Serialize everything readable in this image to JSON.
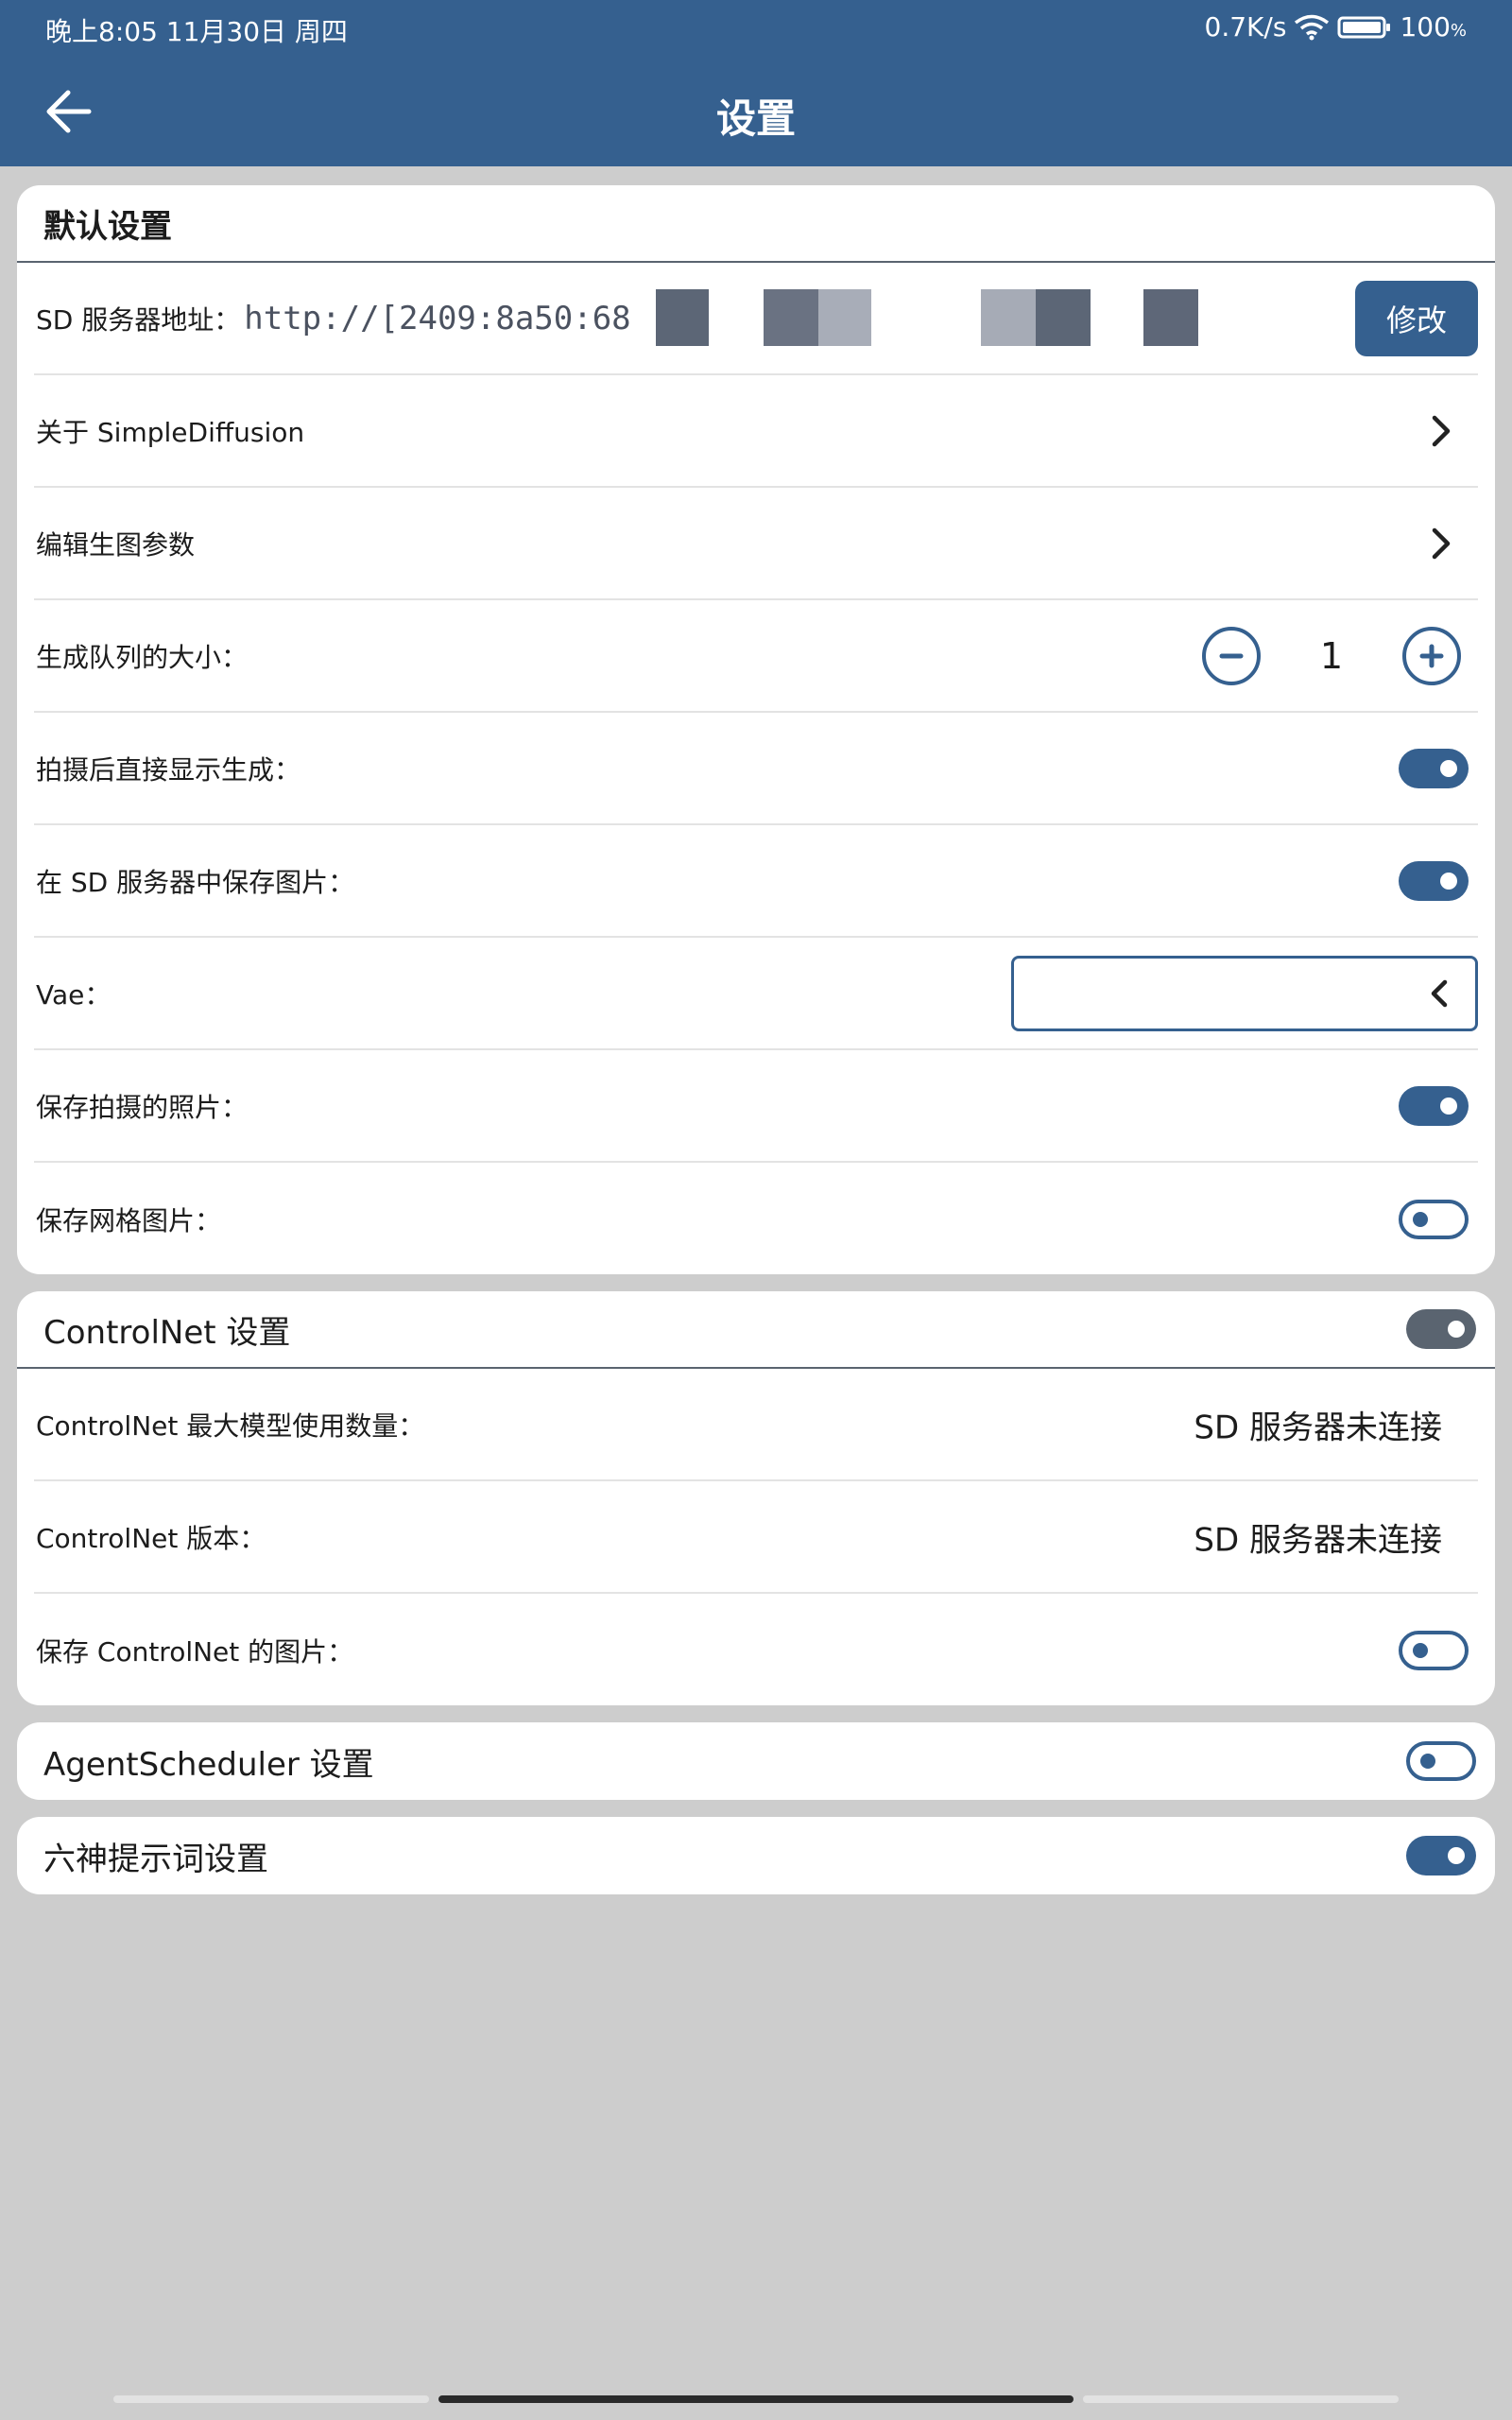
{
  "status_bar": {
    "time": "晚上8:05 11月30日 周四",
    "net_speed": "0.7K/s",
    "battery": "100",
    "battery_unit": "%"
  },
  "app_bar": {
    "title": "设置",
    "back_icon": "arrow-left-icon"
  },
  "default_settings": {
    "header": "默认设置",
    "server_label": "SD 服务器地址：",
    "server_value": "http://[2409:8a50:68",
    "edit_button": "修改",
    "about_label": "关于 SimpleDiffusion",
    "edit_params_label": "编辑生图参数",
    "queue_label": "生成队列的大小：",
    "queue_value": "1",
    "show_after_capture_label": "拍摄后直接显示生成：",
    "show_after_capture": true,
    "save_on_server_label": "在 SD 服务器中保存图片：",
    "save_on_server": true,
    "vae_label": "Vae：",
    "vae_value": "",
    "save_photo_label": "保存拍摄的照片：",
    "save_photo": true,
    "save_grid_label": "保存网格图片：",
    "save_grid": false
  },
  "controlnet": {
    "header": "ControlNet 设置",
    "enabled": true,
    "max_models_label": "ControlNet 最大模型使用数量：",
    "max_models_value": "SD 服务器未连接",
    "version_label": "ControlNet 版本：",
    "version_value": "SD 服务器未连接",
    "save_images_label": "保存 ControlNet 的图片：",
    "save_images": false
  },
  "agent_scheduler": {
    "header": "AgentScheduler 设置",
    "enabled": false
  },
  "prompt_settings": {
    "header": "六神提示词设置",
    "enabled": true
  },
  "colors": {
    "primary": "#35608f",
    "background": "#cdcdcd",
    "card": "#ffffff"
  }
}
